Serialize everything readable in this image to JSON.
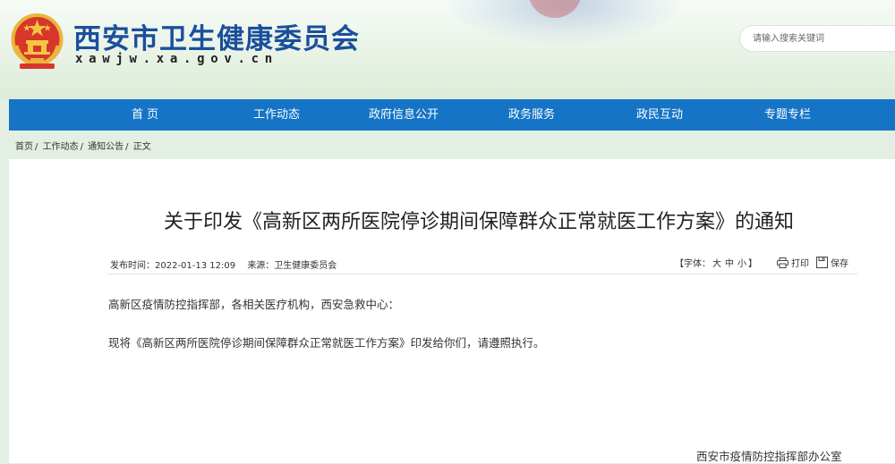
{
  "header": {
    "site_title": "西安市卫生健康委员会",
    "site_domain": "xawjw.xa.gov.cn",
    "search_placeholder": "请输入搜索关键词"
  },
  "nav": {
    "items": [
      {
        "label": "首 页"
      },
      {
        "label": "工作动态"
      },
      {
        "label": "政府信息公开"
      },
      {
        "label": "政务服务"
      },
      {
        "label": "政民互动"
      },
      {
        "label": "专题专栏"
      }
    ]
  },
  "breadcrumb": {
    "items": [
      "首页",
      "工作动态",
      "通知公告",
      "正文"
    ],
    "separator": "/"
  },
  "article": {
    "title": "关于印发《高新区两所医院停诊期间保障群众正常就医工作方案》的通知",
    "publish_time": "发布时间：2022-01-13 12:09",
    "source": "来源：卫生健康委员会",
    "font_size_prefix": "【字体：",
    "font_sizes": [
      "大",
      "中",
      "小"
    ],
    "font_size_suffix": "】",
    "print_label": "打印",
    "save_label": "保存",
    "paragraphs": [
      "高新区疫情防控指挥部，各相关医疗机构，西安急救中心：",
      "现将《高新区两所医院停诊期间保障群众正常就医工作方案》印发给你们，请遵照执行。"
    ],
    "signer": "西安市疫情防控指挥部办公室"
  },
  "colors": {
    "nav_bg": "#1574c6",
    "title_blue": "#1b4f9c",
    "page_bg": "#e3efe2"
  }
}
